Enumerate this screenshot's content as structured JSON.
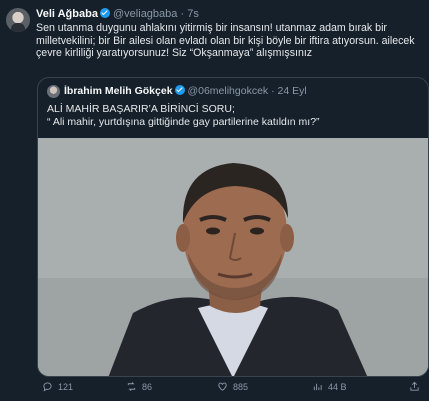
{
  "tweet": {
    "author_name": "Veli Ağbaba",
    "author_handle": "@veliagbaba",
    "separator": "·",
    "time": "7s",
    "body": "Sen utanma duygunu ahlakını yitirmiş bir insansın! utanmaz adam bırak bir milletvekilini; bir Bir ailesi olan evladı olan bir kişi böyle bir iftira atıyorsun. ailecek çevre kirliliği yaratıyorsunuz! Siz “Okşanmaya” alışmışsınız"
  },
  "quoted": {
    "author_name": "İbrahim Melih Gökçek",
    "author_handle": "@06melihgokcek",
    "separator": "·",
    "date": "24 Eyl",
    "line1": "ALİ MAHİR BAŞARIR’A BİRİNCİ SORU;",
    "line2": "“ Ali mahir, yurtdışına gittiğinde gay partilerine katıldın mı?”"
  },
  "actions": {
    "replies": "121",
    "retweets": "86",
    "likes": "885",
    "views": "44 B"
  },
  "icons": {
    "reply": "reply-icon",
    "retweet": "retweet-icon",
    "like": "heart-icon",
    "views": "views-icon",
    "share": "share-icon"
  },
  "colors": {
    "background": "#15202b",
    "verified": "#1d9bf0",
    "muted": "#8b98a5",
    "border": "#38444d"
  }
}
